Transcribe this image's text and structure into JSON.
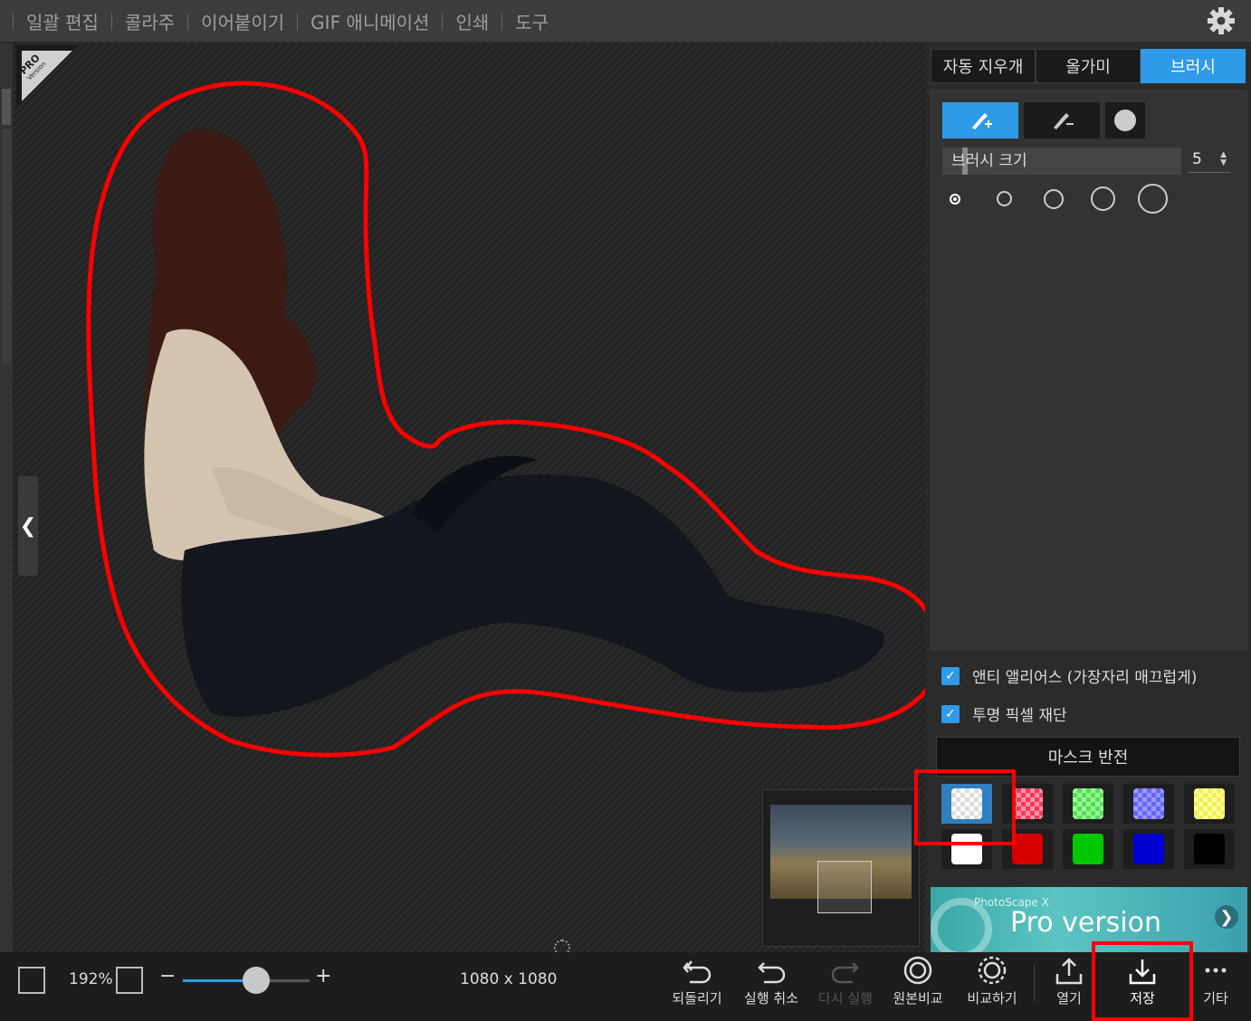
{
  "menu": {
    "items": [
      "일괄 편집",
      "콜라주",
      "이어붙이기",
      "GIF 애니메이션",
      "인쇄",
      "도구"
    ]
  },
  "canvas": {
    "pro_badge": {
      "line1": "PRO",
      "line2": "Version"
    }
  },
  "panel": {
    "tabs": [
      "자동 지우개",
      "올가미",
      "브러시"
    ],
    "active_tab": "브러시",
    "brush_size_label": "브러시 크기",
    "brush_size_value": "5",
    "antialias_label": "앤티 앨리어스 (가장자리 매끄럽게)",
    "transparent_crop_label": "투명 픽셀 재단",
    "mask_invert_label": "마스크 반전",
    "mask_colors": [
      "#ffffff-checker",
      "#ff6666-checker",
      "#66dd66-checker",
      "#7777ff-checker",
      "#eeee66-checker",
      "#ffffff",
      "#d60000",
      "#00c800",
      "#0000d0",
      "#000000"
    ],
    "pro_banner": {
      "small": "PhotoScape X",
      "big": "Pro version"
    }
  },
  "bottombar": {
    "zoom": "192%",
    "dimensions": "1080 x 1080",
    "actions": [
      {
        "label": "되돌리기",
        "enabled": true
      },
      {
        "label": "실행 취소",
        "enabled": true
      },
      {
        "label": "다시 실행",
        "enabled": false
      },
      {
        "label": "원본비교",
        "enabled": true
      },
      {
        "label": "비교하기",
        "enabled": true
      },
      {
        "label": "열기",
        "enabled": true
      },
      {
        "label": "저장",
        "enabled": true
      },
      {
        "label": "기타",
        "enabled": true
      }
    ]
  },
  "colors": {
    "accent": "#2f9ae8",
    "annotation": "#ff0000"
  }
}
